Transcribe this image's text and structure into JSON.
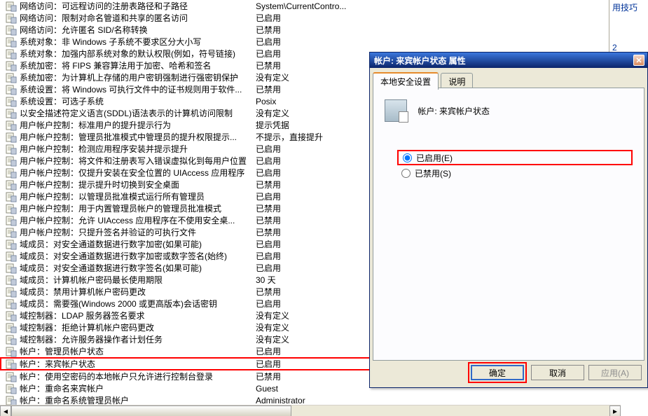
{
  "side_links": [
    "用技巧",
    "2"
  ],
  "list": [
    {
      "name": "网络访问：可远程访问的注册表路径和子路径",
      "value": "System\\CurrentContro..."
    },
    {
      "name": "网络访问：限制对命名管道和共享的匿名访问",
      "value": "已启用"
    },
    {
      "name": "网络访问：允许匿名 SID/名称转换",
      "value": "已禁用"
    },
    {
      "name": "系统对象：非 Windows 子系统不要求区分大小写",
      "value": "已启用"
    },
    {
      "name": "系统对象：加强内部系统对象的默认权限(例如，符号链接)",
      "value": "已启用"
    },
    {
      "name": "系统加密：将 FIPS 兼容算法用于加密、哈希和签名",
      "value": "已禁用"
    },
    {
      "name": "系统加密：为计算机上存储的用户密钥强制进行强密钥保护",
      "value": "没有定义"
    },
    {
      "name": "系统设置：将 Windows 可执行文件中的证书规则用于软件...",
      "value": "已禁用"
    },
    {
      "name": "系统设置：可选子系统",
      "value": "Posix"
    },
    {
      "name": "以安全描述符定义语言(SDDL)语法表示的计算机访问限制",
      "value": "没有定义"
    },
    {
      "name": "用户帐户控制：标准用户的提升提示行为",
      "value": "提示凭据"
    },
    {
      "name": "用户帐户控制：管理员批准模式中管理员的提升权限提示...",
      "value": "不提示，直接提升"
    },
    {
      "name": "用户帐户控制：检测应用程序安装并提示提升",
      "value": "已启用"
    },
    {
      "name": "用户帐户控制：将文件和注册表写入错误虚拟化到每用户位置",
      "value": "已启用"
    },
    {
      "name": "用户帐户控制：仅提升安装在安全位置的 UIAccess 应用程序",
      "value": "已启用"
    },
    {
      "name": "用户帐户控制：提示提升时切换到安全桌面",
      "value": "已禁用"
    },
    {
      "name": "用户帐户控制：以管理员批准模式运行所有管理员",
      "value": "已启用"
    },
    {
      "name": "用户帐户控制：用于内置管理员帐户的管理员批准模式",
      "value": "已禁用"
    },
    {
      "name": "用户帐户控制：允许 UIAccess 应用程序在不使用安全桌...",
      "value": "已禁用"
    },
    {
      "name": "用户帐户控制：只提升签名并验证的可执行文件",
      "value": "已禁用"
    },
    {
      "name": "域成员：对安全通道数据进行数字加密(如果可能)",
      "value": "已启用"
    },
    {
      "name": "域成员：对安全通道数据进行数字加密或数字签名(始终)",
      "value": "已启用"
    },
    {
      "name": "域成员：对安全通道数据进行数字签名(如果可能)",
      "value": "已启用"
    },
    {
      "name": "域成员：计算机帐户密码最长使用期限",
      "value": "30 天"
    },
    {
      "name": "域成员：禁用计算机帐户密码更改",
      "value": "已禁用"
    },
    {
      "name": "域成员：需要强(Windows 2000 或更高版本)会话密钥",
      "value": "已启用"
    },
    {
      "name": "域控制器：LDAP 服务器签名要求",
      "value": "没有定义"
    },
    {
      "name": "域控制器：拒绝计算机帐户密码更改",
      "value": "没有定义"
    },
    {
      "name": "域控制器：允许服务器操作者计划任务",
      "value": "没有定义"
    },
    {
      "name": "帐户：管理员帐户状态",
      "value": "已启用"
    },
    {
      "name": "帐户：来宾帐户状态",
      "value": "已启用",
      "highlighted": true
    },
    {
      "name": "帐户：使用空密码的本地帐户只允许进行控制台登录",
      "value": "已禁用"
    },
    {
      "name": "帐户：重命名来宾帐户",
      "value": "Guest"
    },
    {
      "name": "帐户：重命名系统管理员帐户",
      "value": "Administrator"
    }
  ],
  "dialog": {
    "title": "帐户: 来宾帐户状态 属性",
    "tabs": {
      "active": "本地安全设置",
      "other": "说明"
    },
    "policy_name": "帐户: 来宾帐户状态",
    "radios": {
      "enabled": "已启用(E)",
      "disabled": "已禁用(S)",
      "selected": "enabled"
    },
    "buttons": {
      "ok": "确定",
      "cancel": "取消",
      "apply": "应用(A)"
    }
  }
}
